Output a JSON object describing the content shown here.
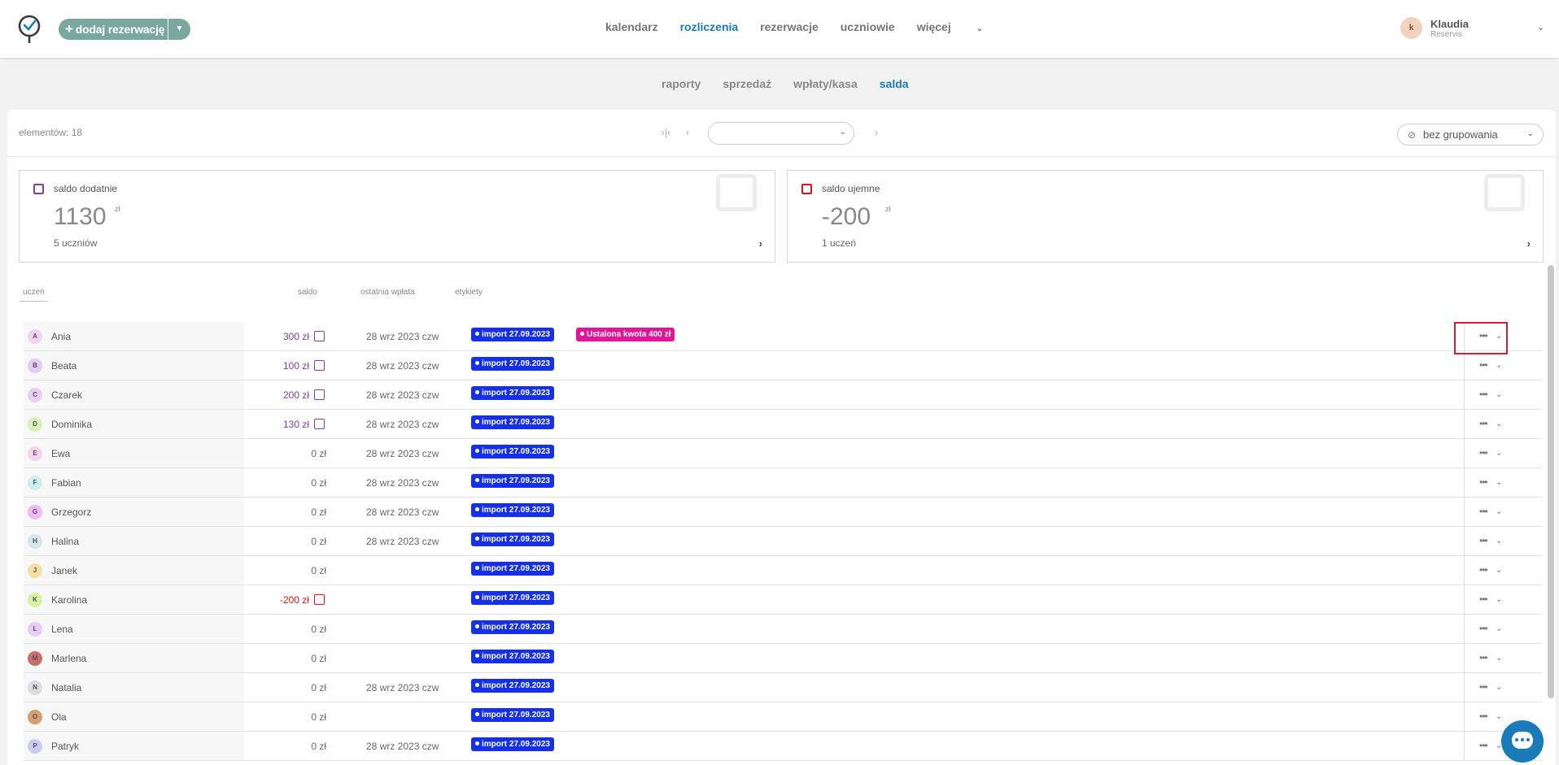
{
  "topbar": {
    "add_button_label": "dodaj rezerwację",
    "nav": [
      "kalendarz",
      "rozliczenia",
      "rezerwacje",
      "uczniowie",
      "więcej"
    ],
    "active_nav": "rozliczenia",
    "user": {
      "initial": "k",
      "name": "Klaudia",
      "company": "Reservis"
    }
  },
  "subnav": {
    "items": [
      "raporty",
      "sprzedaż",
      "wpłaty/kasa",
      "salda"
    ],
    "active": "salda"
  },
  "toolbar": {
    "elements_label": "elementów: 18",
    "period_value": "",
    "grouping_label": "bez grupowania"
  },
  "cards": {
    "positive": {
      "title": "saldo dodatnie",
      "value": "1130",
      "unit": "zł",
      "count": "5 uczniów"
    },
    "negative": {
      "title": "saldo ujemne",
      "value": "-200",
      "unit": "zł",
      "count": "1 uczeń"
    }
  },
  "table": {
    "headers": {
      "student": "uczeń",
      "balance": "saldo",
      "last_payment": "ostatnia wpłata",
      "labels": "etykiety"
    },
    "rows": [
      {
        "initial": "A",
        "name": "Ania",
        "balance": "300 zł",
        "sign": "pos",
        "date": "28 wrz 2023 czw",
        "tags": [
          "import 27.09.2023",
          "Ustalona kwota 400 zł"
        ]
      },
      {
        "initial": "B",
        "name": "Beata",
        "balance": "100 zł",
        "sign": "pos",
        "date": "28 wrz 2023 czw",
        "tags": [
          "import 27.09.2023"
        ]
      },
      {
        "initial": "C",
        "name": "Czarek",
        "balance": "200 zł",
        "sign": "pos",
        "date": "28 wrz 2023 czw",
        "tags": [
          "import 27.09.2023"
        ]
      },
      {
        "initial": "D",
        "name": "Dominika",
        "balance": "130 zł",
        "sign": "pos",
        "date": "28 wrz 2023 czw",
        "tags": [
          "import 27.09.2023"
        ]
      },
      {
        "initial": "E",
        "name": "Ewa",
        "balance": "0 zł",
        "sign": "zero",
        "date": "28 wrz 2023 czw",
        "tags": [
          "import 27.09.2023"
        ]
      },
      {
        "initial": "F",
        "name": "Fabian",
        "balance": "0 zł",
        "sign": "zero",
        "date": "28 wrz 2023 czw",
        "tags": [
          "import 27.09.2023"
        ]
      },
      {
        "initial": "G",
        "name": "Grzegorz",
        "balance": "0 zł",
        "sign": "zero",
        "date": "28 wrz 2023 czw",
        "tags": [
          "import 27.09.2023"
        ]
      },
      {
        "initial": "H",
        "name": "Halina",
        "balance": "0 zł",
        "sign": "zero",
        "date": "28 wrz 2023 czw",
        "tags": [
          "import 27.09.2023"
        ]
      },
      {
        "initial": "J",
        "name": "Janek",
        "balance": "0 zł",
        "sign": "zero",
        "date": "",
        "tags": [
          "import 27.09.2023"
        ]
      },
      {
        "initial": "K",
        "name": "Karolina",
        "balance": "-200 zł",
        "sign": "neg",
        "date": "",
        "tags": [
          "import 27.09.2023"
        ]
      },
      {
        "initial": "L",
        "name": "Lena",
        "balance": "0 zł",
        "sign": "zero",
        "date": "",
        "tags": [
          "import 27.09.2023"
        ]
      },
      {
        "initial": "M",
        "name": "Marlena",
        "balance": "0 zł",
        "sign": "zero",
        "date": "",
        "tags": [
          "import 27.09.2023"
        ]
      },
      {
        "initial": "N",
        "name": "Natalia",
        "balance": "0 zł",
        "sign": "zero",
        "date": "28 wrz 2023 czw",
        "tags": [
          "import 27.09.2023"
        ]
      },
      {
        "initial": "O",
        "name": "Ola",
        "balance": "0 zł",
        "sign": "zero",
        "date": "",
        "tags": [
          "import 27.09.2023"
        ]
      },
      {
        "initial": "P",
        "name": "Patryk",
        "balance": "0 zł",
        "sign": "zero",
        "date": "28 wrz 2023 czw",
        "tags": [
          "import 27.09.2023"
        ]
      }
    ]
  },
  "colors": {
    "accent": "#1a7bb9",
    "add_button": "#7aa89e",
    "tag_import": "#1530e8",
    "tag_amount": "#e0159a",
    "positive": "#7b3fa6",
    "negative": "#d9151b",
    "avatar_colors": [
      "#f0d4f2",
      "#e3ccf2",
      "#e8cff2",
      "#d7f1b6",
      "#f6d3ec",
      "#cdeff0",
      "#f3b7f2",
      "#cfe9ea",
      "#f5dfa3",
      "#d6f3a4",
      "#e6ccf7",
      "#c96e6a",
      "#dcdcdc",
      "#d4a06f",
      "#c9cdee"
    ]
  },
  "icons": {
    "logo": "reservis-logo",
    "chat": "chat-bubble-icon"
  }
}
